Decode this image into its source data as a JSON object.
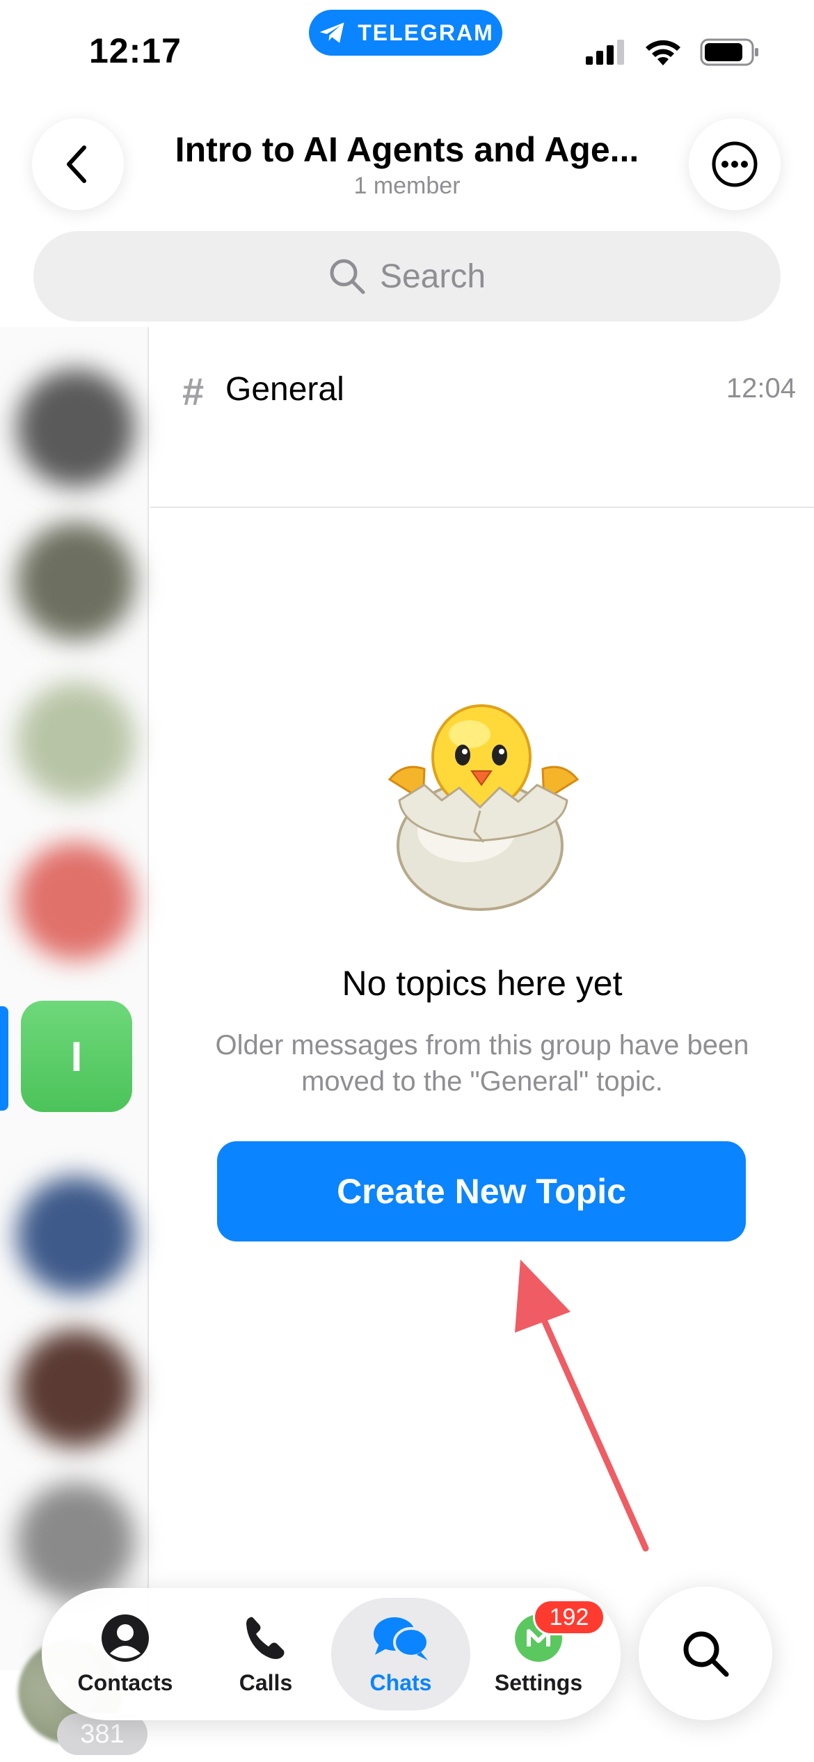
{
  "status_bar": {
    "time": "12:17",
    "app_pill_label": "TELEGRAM"
  },
  "header": {
    "title": "Intro to AI Agents and Age...",
    "subtitle": "1 member"
  },
  "search": {
    "placeholder": "Search"
  },
  "topics": [
    {
      "name": "General",
      "time": "12:04"
    }
  ],
  "sidebar": {
    "active_chat_initial": "I"
  },
  "empty_state": {
    "title": "No topics here yet",
    "description": "Older messages from this group have been moved to the \"General\" topic.",
    "button_label": "Create New Topic"
  },
  "tab_bar": {
    "tabs": [
      {
        "label": "Contacts",
        "icon": "person-circle-icon"
      },
      {
        "label": "Calls",
        "icon": "phone-icon"
      },
      {
        "label": "Chats",
        "icon": "chat-bubbles-icon",
        "active": true
      },
      {
        "label": "Settings",
        "icon": "settings-avatar-icon",
        "badge": "192"
      }
    ]
  },
  "bottom": {
    "unread_count": "381"
  },
  "colors": {
    "accent": "#0a84ff",
    "badge": "#ff3b30",
    "annotation_arrow": "#ef5c63"
  }
}
